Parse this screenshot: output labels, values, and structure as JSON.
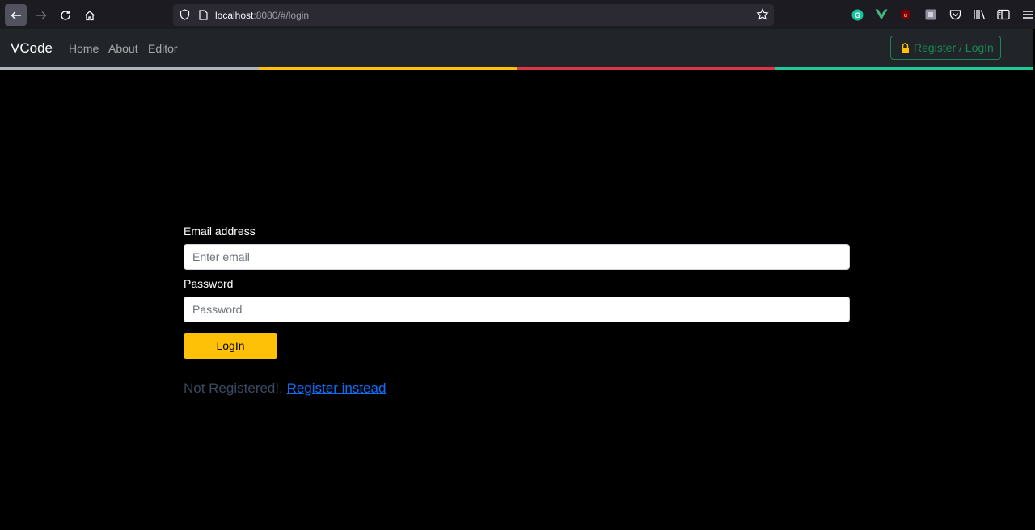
{
  "browser": {
    "url_host": "localhost",
    "url_rest": ":8080/#/login"
  },
  "navbar": {
    "brand": "VCode",
    "links": [
      "Home",
      "About",
      "Editor"
    ],
    "register_label": "Register / LogIn"
  },
  "form": {
    "email_label": "Email address",
    "email_placeholder": "Enter email",
    "email_value": "",
    "password_label": "Password",
    "password_placeholder": "Password",
    "password_value": "",
    "login_label": "LogIn"
  },
  "footer": {
    "not_registered_text": "Not Registered!,",
    "register_link_text": "Register instead"
  },
  "colors": {
    "accent_yellow": "#ffc107",
    "success_green": "#198754",
    "link_blue": "#0d6efd",
    "stripe_grey": "#adb5bd",
    "stripe_red": "#dc3545",
    "stripe_teal": "#20c997"
  }
}
